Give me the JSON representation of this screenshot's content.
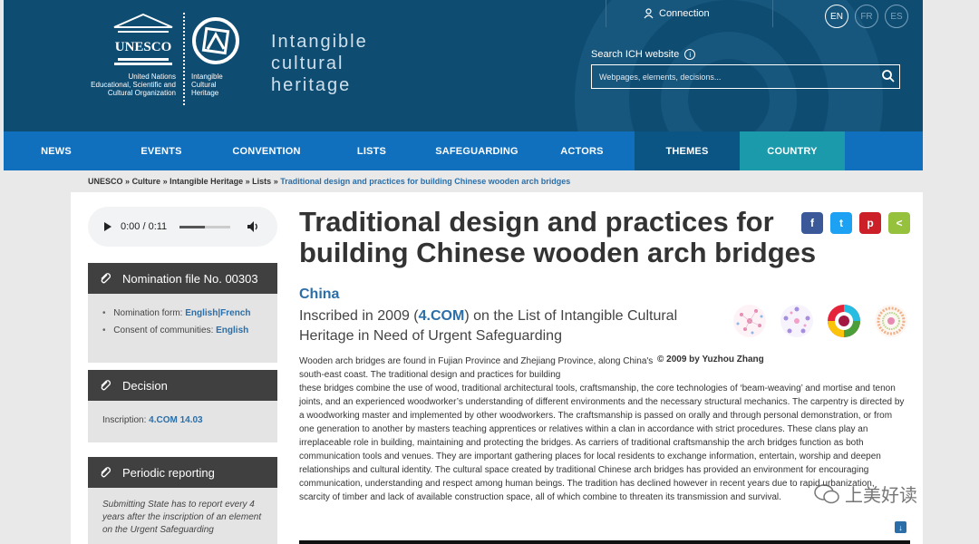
{
  "header": {
    "un_text": [
      "United Nations",
      "Educational, Scientific and",
      "Cultural Organization"
    ],
    "ich_small": [
      "Intangible",
      "Cultural",
      "Heritage"
    ],
    "ich_big": [
      "Intangible",
      "cultural",
      "heritage"
    ],
    "unesco_logo_text": "UNESCO",
    "connection": "Connection",
    "languages": [
      "EN",
      "FR",
      "ES"
    ],
    "search_label": "Search ICH website",
    "search_placeholder": "Webpages, elements, decisions..."
  },
  "nav": [
    "NEWS",
    "EVENTS",
    "CONVENTION",
    "LISTS",
    "SAFEGUARDING",
    "ACTORS",
    "THEMES",
    "COUNTRY"
  ],
  "breadcrumb": {
    "items": [
      "UNESCO",
      "Culture",
      "Intangible Heritage",
      "Lists"
    ],
    "separator": "»",
    "current": "Traditional design and practices for building Chinese wooden arch bridges"
  },
  "audio": {
    "time": "0:00 / 0:11",
    "progress": 0.5
  },
  "sidebar": {
    "nomination": {
      "title": "Nomination file No. 00303",
      "form_label": "Nomination form: ",
      "form_en": "English",
      "form_sep": "|",
      "form_fr": "French",
      "consent_label": "Consent of communities: ",
      "consent_en": "English"
    },
    "decision": {
      "title": "Decision",
      "label": "Inscription: ",
      "value": "4.COM 14.03"
    },
    "periodic": {
      "title": "Periodic reporting",
      "text": "Submitting State has to report every 4 years after the inscription of an element on the Urgent Safeguarding"
    }
  },
  "main": {
    "title": "Traditional design and practices for building Chinese wooden arch bridges",
    "country": "China",
    "inscribed_pre": "Inscribed in 2009 (",
    "inscribed_link": "4.COM",
    "inscribed_post": ") on the List of Intangible Cultural Heritage in Need of Urgent Safeguarding",
    "credit": "© 2009 by Yuzhou Zhang",
    "desc_intro": "Wooden arch bridges are found in Fujian Province and Zhejiang Province, along China's south-east coast. The traditional design and practices for building",
    "desc_body": "these bridges combine the use of wood, traditional architectural tools, craftsmanship, the core technologies of ‘beam-weaving’ and mortise and tenon joints, and an experienced woodworker’s understanding of different environments and the necessary structural mechanics. The carpentry is directed by a woodworking master and implemented by other woodworkers. The craftsmanship is passed on orally and through personal demonstration, or from one generation to another by masters teaching apprentices or relatives within a clan in accordance with strict procedures. These clans play an irreplaceable role in building, maintaining and protecting the bridges. As carriers of traditional craftsmanship the arch bridges function as both communication tools and venues. They are important gathering places for local residents to exchange information, entertain, worship and deepen relationships and cultural identity. The cultural space created by traditional Chinese arch bridges has provided an environment for encouraging communication, understanding and respect among human beings. The tradition has declined however in recent years due to rapid urbanization, scarcity of timber and lack of available construction space, all of which combine to threaten its transmission and survival.",
    "share": [
      "f",
      "t",
      "p",
      "<"
    ]
  },
  "watermark": "上美好读",
  "colors": {
    "header_bg": "#0e4c72",
    "nav_bg": "#1170be",
    "link": "#2b6ea8",
    "facebook": "#3b5998",
    "twitter": "#1da1f2",
    "pinterest": "#cb2027",
    "share": "#95c13d"
  }
}
